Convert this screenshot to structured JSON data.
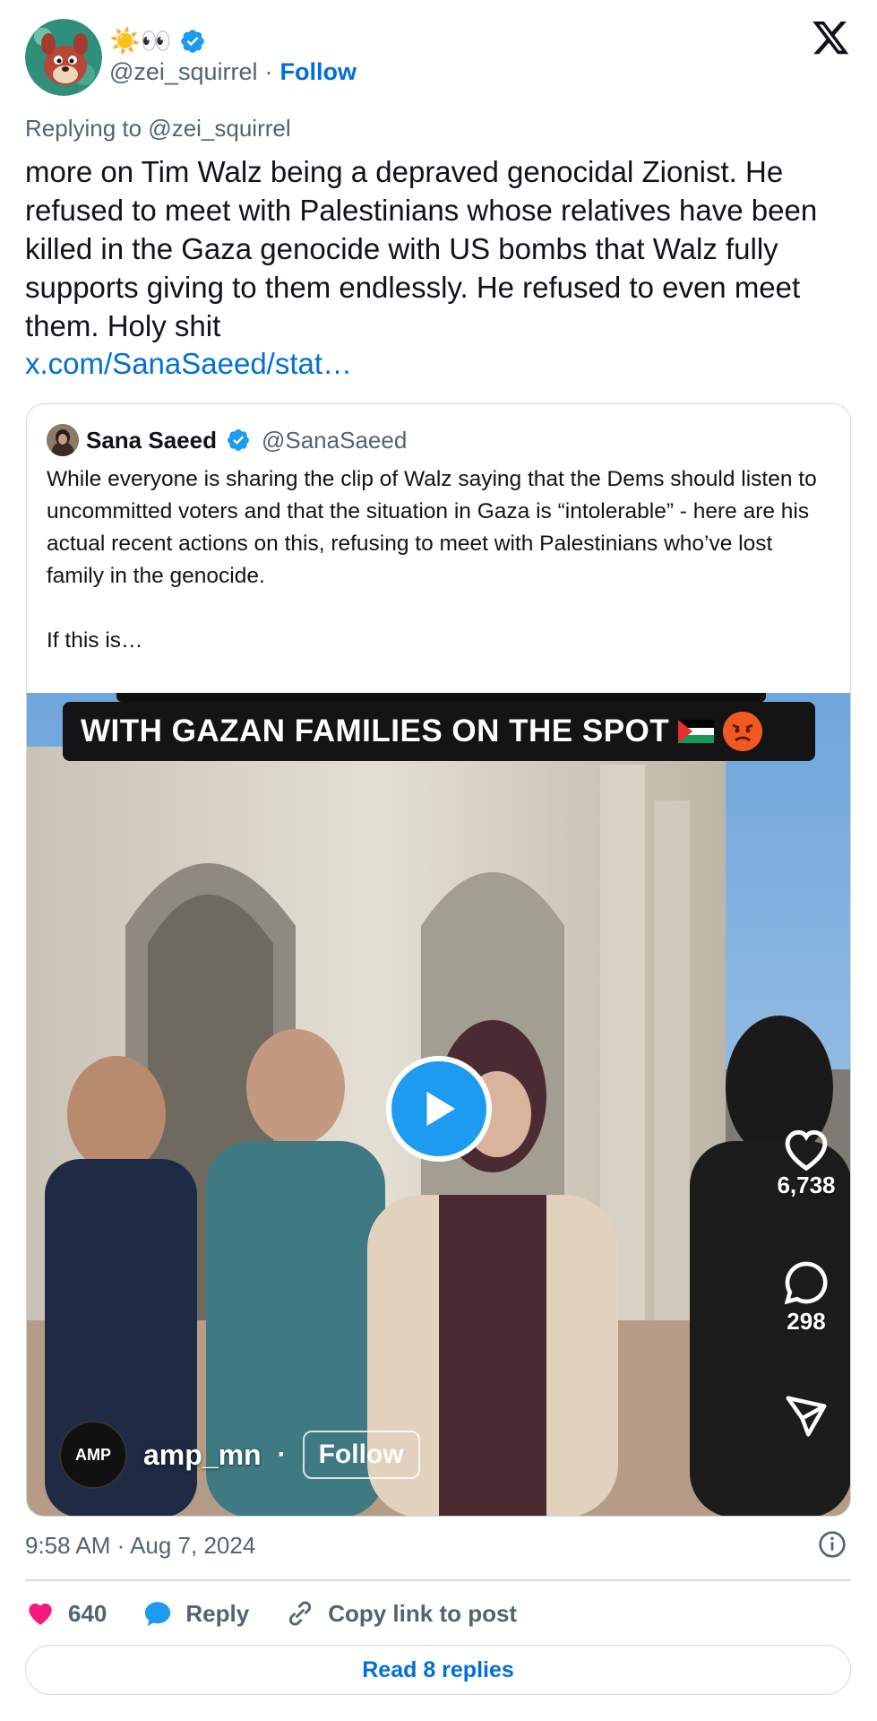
{
  "author": {
    "display_name": "☀️👀",
    "handle": "@zei_squirrel",
    "separator": "·",
    "follow_label": "Follow"
  },
  "reply_to": "Replying to @zei_squirrel",
  "tweet": {
    "text": "more on Tim Walz being a depraved genocidal Zionist. He refused to meet with Palestinians whose relatives have been killed in the Gaza genocide with US bombs that Walz fully supports giving to them endlessly. He refused to even meet them. Holy shit",
    "link": "x.com/SanaSaeed/stat…"
  },
  "quote": {
    "name": "Sana Saeed",
    "handle": "@SanaSaeed",
    "text": "While everyone is sharing the clip of Walz saying that the Dems should listen to uncommitted voters and that the situation in Gaza is “intolerable” - here are his actual recent actions on this, refusing to meet with Palestinians who’ve lost family in the genocide.\n\nIf this is…",
    "media": {
      "banner_text": "WITH GAZAN FAMILIES ON THE SPOT",
      "likes": "6,738",
      "comments": "298",
      "account_logo": "AMP",
      "account_name": "amp_mn",
      "dot": "·",
      "follow_label": "Follow"
    }
  },
  "timestamp": "9:58 AM · Aug 7, 2024",
  "actions": {
    "like_count": "640",
    "reply_label": "Reply",
    "copy_label": "Copy link to post"
  },
  "read_replies_label": "Read 8 replies",
  "colors": {
    "link_blue": "#006fd6",
    "verified_blue": "#1d9bf0",
    "like_pink": "#f91880",
    "muted_gray": "#536471",
    "border_gray": "#cfd9de"
  },
  "icons": {
    "verified": "verified-badge-icon",
    "x_logo": "x-logo-icon",
    "info": "info-icon",
    "heart": "heart-icon",
    "reply": "speech-bubble-icon",
    "copy": "link-icon",
    "play": "play-icon"
  }
}
